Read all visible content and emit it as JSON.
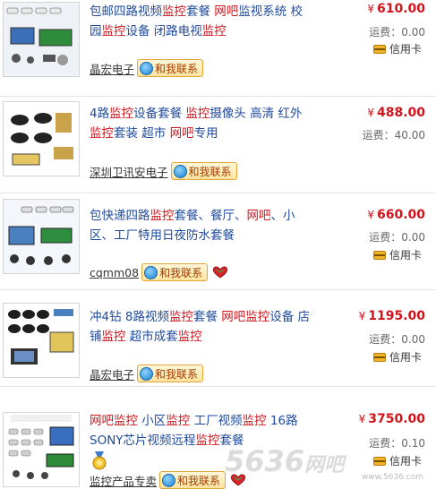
{
  "listings": [
    {
      "title_parts": [
        {
          "t": "包邮四路视频"
        },
        {
          "t": "监控",
          "hl": true
        },
        {
          "t": "套餐 "
        },
        {
          "t": "网吧",
          "hl": true
        },
        {
          "t": "监视系统 校园"
        },
        {
          "t": "监控",
          "hl": true
        },
        {
          "t": "设备 闭路电视"
        },
        {
          "t": "监控",
          "hl": true
        }
      ],
      "seller": "晶宏电子",
      "contact": "和我联系",
      "price_symbol": "¥",
      "price": "610.00",
      "shipping": "运费：0.00",
      "card": "信用卡"
    },
    {
      "title_parts": [
        {
          "t": "4路"
        },
        {
          "t": "监控",
          "hl": true
        },
        {
          "t": "设备套餐 "
        },
        {
          "t": "监控",
          "hl": true
        },
        {
          "t": "摄像头 高清 红外 "
        },
        {
          "t": "监控",
          "hl": true
        },
        {
          "t": "套装 超市 "
        },
        {
          "t": "网吧",
          "hl": true
        },
        {
          "t": "专用"
        }
      ],
      "seller": "深圳卫讯安电子",
      "contact": "和我联系",
      "price_symbol": "¥",
      "price": "488.00",
      "shipping": "运费：40.00",
      "card": ""
    },
    {
      "title_parts": [
        {
          "t": "包快递四路"
        },
        {
          "t": "监控",
          "hl": true
        },
        {
          "t": "套餐、餐厅、"
        },
        {
          "t": "网吧",
          "hl": true
        },
        {
          "t": "、小区、工厂特用日夜防水套餐"
        }
      ],
      "seller": "cqmm08",
      "contact": "和我联系",
      "price_symbol": "¥",
      "price": "660.00",
      "shipping": "运费：0.00",
      "card": "信用卡"
    },
    {
      "title_parts": [
        {
          "t": "冲4钻 8路视频"
        },
        {
          "t": "监控",
          "hl": true
        },
        {
          "t": "套餐 "
        },
        {
          "t": "网吧",
          "hl": true
        },
        {
          "t": "监控",
          "hl": true
        },
        {
          "t": "设备 店铺"
        },
        {
          "t": "监控",
          "hl": true
        },
        {
          "t": " 超市成套"
        },
        {
          "t": "监控",
          "hl": true
        }
      ],
      "seller": "晶宏电子",
      "contact": "和我联系",
      "price_symbol": "¥",
      "price": "1195.00",
      "shipping": "运费：0.00",
      "card": "信用卡"
    },
    {
      "title_parts": [
        {
          "t": "网吧",
          "hl": true
        },
        {
          "t": "监控",
          "hl": true
        },
        {
          "t": " 小区"
        },
        {
          "t": "监控",
          "hl": true
        },
        {
          "t": " 工厂视频"
        },
        {
          "t": "监控",
          "hl": true
        },
        {
          "t": " 16路SONY芯片视频远程"
        },
        {
          "t": "监控",
          "hl": true
        },
        {
          "t": "套餐"
        }
      ],
      "seller": "监控产品专卖",
      "contact": "和我联系",
      "price_symbol": "¥",
      "price": "3750.00",
      "shipping": "运费：0.10",
      "card": "信用卡"
    }
  ],
  "watermark": {
    "big": "5636",
    "sub": "网吧",
    "small": "www.5636.com"
  },
  "colors": {
    "title": "#1f4a9c",
    "highlight": "#d0141c",
    "price": "#d0141c"
  }
}
